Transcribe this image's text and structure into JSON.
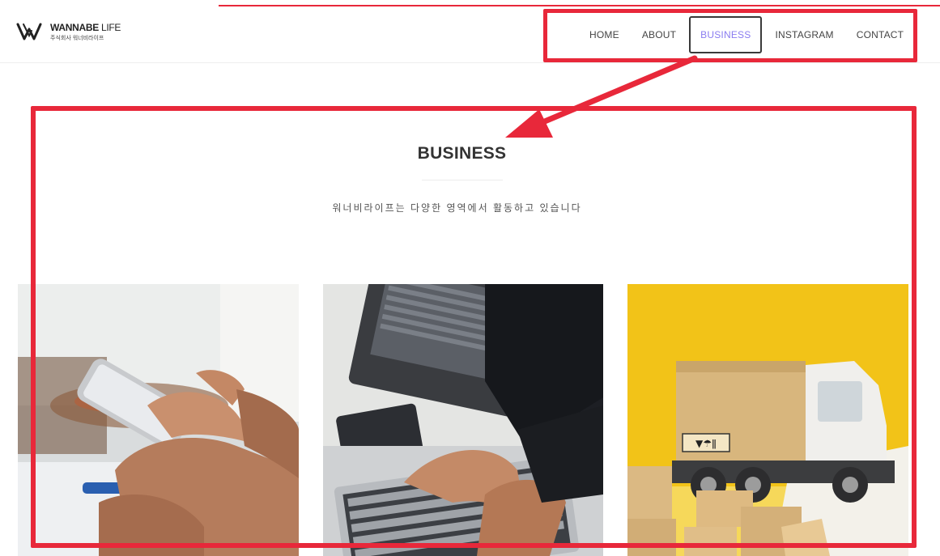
{
  "header": {
    "logo": {
      "icon": "wannabe-w-logo",
      "name_bold": "WANNABE",
      "name_light": " LIFE",
      "sub": "주식회사 워너비라이프"
    },
    "nav": [
      {
        "label": "HOME",
        "active": false
      },
      {
        "label": "ABOUT",
        "active": false
      },
      {
        "label": "BUSINESS",
        "active": true
      },
      {
        "label": "INSTAGRAM",
        "active": false
      },
      {
        "label": "CONTACT",
        "active": false
      }
    ]
  },
  "section": {
    "title": "BUSINESS",
    "subtitle": "워너비라이프는 다양한 영역에서 활동하고 있습니다"
  },
  "cards": [
    {
      "image": "smartphone-hands-photo"
    },
    {
      "image": "laptop-typing-photo"
    },
    {
      "image": "delivery-truck-boxes-photo"
    }
  ],
  "colors": {
    "accent": "#8a7cf0",
    "annotation": "#e8283a",
    "text": "#333333"
  }
}
